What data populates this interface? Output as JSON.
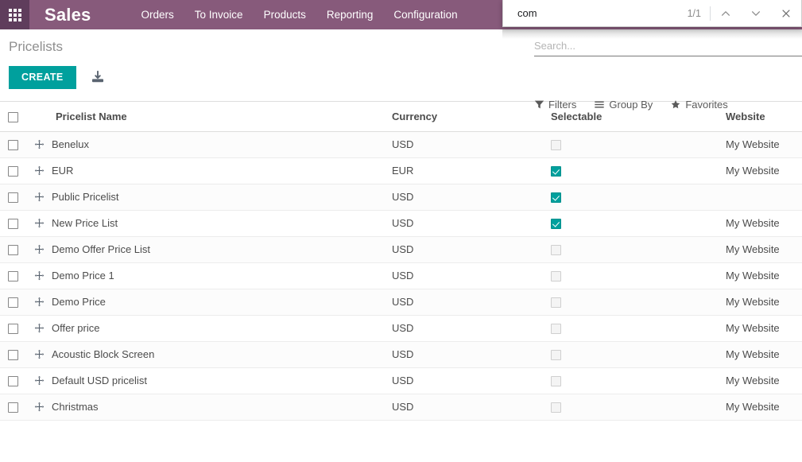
{
  "navbar": {
    "apps_icon": "apps-grid-icon",
    "brand": "Sales",
    "menu": [
      {
        "label": "Orders"
      },
      {
        "label": "To Invoice"
      },
      {
        "label": "Products"
      },
      {
        "label": "Reporting"
      },
      {
        "label": "Configuration"
      }
    ],
    "background_color": "#875a7b",
    "apps_button_color": "#5f3d5c"
  },
  "findbar": {
    "query": "com",
    "match_count": "1/1",
    "prev_icon": "chevron-up-icon",
    "next_icon": "chevron-down-icon",
    "close_icon": "close-icon"
  },
  "control_panel": {
    "title": "Pricelists",
    "create_label": "CREATE",
    "create_color": "#00a09d",
    "import_icon": "import-icon",
    "search": {
      "value": "",
      "placeholder": "Search..."
    },
    "filters": [
      {
        "label": "Filters",
        "icon": "funnel-icon"
      },
      {
        "label": "Group By",
        "icon": "list-icon"
      },
      {
        "label": "Favorites",
        "icon": "star-icon"
      }
    ]
  },
  "list": {
    "columns": [
      {
        "key": "name",
        "label": "Pricelist Name"
      },
      {
        "key": "currency",
        "label": "Currency"
      },
      {
        "key": "selectable",
        "label": "Selectable"
      },
      {
        "key": "website",
        "label": "Website"
      }
    ],
    "rows": [
      {
        "name": "Benelux",
        "currency": "USD",
        "selectable": false,
        "website": "My Website"
      },
      {
        "name": "EUR",
        "currency": "EUR",
        "selectable": true,
        "website": "My Website"
      },
      {
        "name": "Public Pricelist",
        "currency": "USD",
        "selectable": true,
        "website": ""
      },
      {
        "name": "New Price List",
        "currency": "USD",
        "selectable": true,
        "website": "My Website"
      },
      {
        "name": "Demo Offer Price List",
        "currency": "USD",
        "selectable": false,
        "website": "My Website"
      },
      {
        "name": "Demo Price 1",
        "currency": "USD",
        "selectable": false,
        "website": "My Website"
      },
      {
        "name": "Demo Price",
        "currency": "USD",
        "selectable": false,
        "website": "My Website"
      },
      {
        "name": "Offer price",
        "currency": "USD",
        "selectable": false,
        "website": "My Website"
      },
      {
        "name": "Acoustic Block Screen",
        "currency": "USD",
        "selectable": false,
        "website": "My Website"
      },
      {
        "name": "Default USD pricelist",
        "currency": "USD",
        "selectable": false,
        "website": "My Website"
      },
      {
        "name": "Christmas",
        "currency": "USD",
        "selectable": false,
        "website": "My Website"
      }
    ]
  }
}
